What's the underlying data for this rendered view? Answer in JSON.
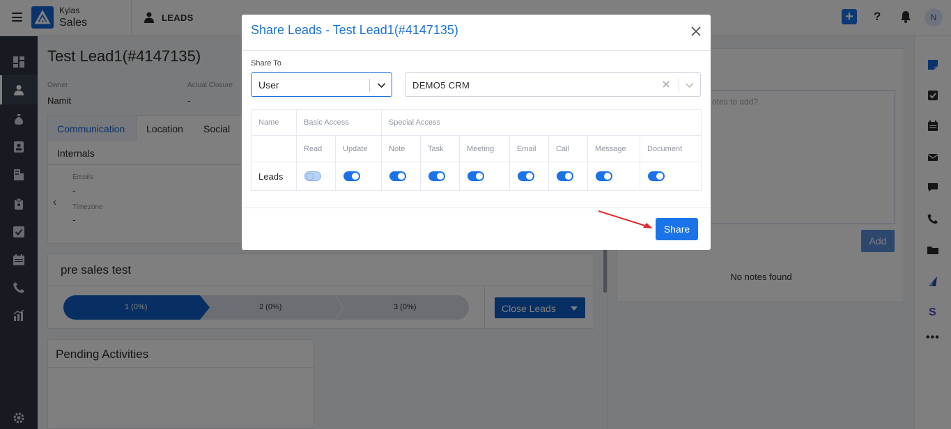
{
  "app": {
    "brand_top": "Kylas",
    "brand_bottom": "Sales",
    "module": "LEADS",
    "avatar_initial": "N",
    "help": "?",
    "plus": "+"
  },
  "sidebar": {
    "items": [
      "dashboard-icon",
      "user-icon",
      "money-bag-icon",
      "contact-card-icon",
      "building-icon",
      "clipboard-icon",
      "checkbox-icon",
      "calendar-icon",
      "phone-icon",
      "reports-icon",
      "gear-icon"
    ]
  },
  "lead": {
    "title": "Test Lead1(#4147135)",
    "owner_label": "Owner",
    "owner_value": "Namit",
    "closure_label": "Actual Closure",
    "closure_value": "-",
    "tabs": [
      "Communication",
      "Location",
      "Social",
      "Internals"
    ],
    "fields": [
      {
        "label": "Emails",
        "value": "-"
      },
      {
        "label": "Timezone",
        "value": "-"
      }
    ]
  },
  "pipeline": {
    "title": "pre sales test",
    "stages": [
      "1 (0%)",
      "2 (0%)",
      "3 (0%)"
    ],
    "close_button": "Close Leads"
  },
  "pending": {
    "title": "Pending Activities"
  },
  "notes": {
    "placeholder": "otes to add?",
    "add_button": "Add",
    "empty_text": "No notes found"
  },
  "modal": {
    "title": "Share Leads - Test Lead1(#4147135)",
    "share_to_label": "Share To",
    "share_type": "User",
    "share_user": "DEMO5 CRM",
    "header_row1": {
      "name": "Name",
      "basic": "Basic Access",
      "special": "Special Access"
    },
    "columns": [
      "Read",
      "Update",
      "Note",
      "Task",
      "Meeting",
      "Email",
      "Call",
      "Message",
      "Document"
    ],
    "rows": [
      {
        "name": "Leads",
        "read": "disabled",
        "update": true,
        "note": true,
        "task": true,
        "meeting": true,
        "email": true,
        "call": true,
        "message": true,
        "document": true
      }
    ],
    "share_button": "Share"
  },
  "colors": {
    "primary": "#1a73e8",
    "title_blue": "#1b73d8",
    "sidebar_bg": "#2f3541",
    "pipeline_active": "#0f5fc7",
    "arrow_red": "#e0282e"
  }
}
